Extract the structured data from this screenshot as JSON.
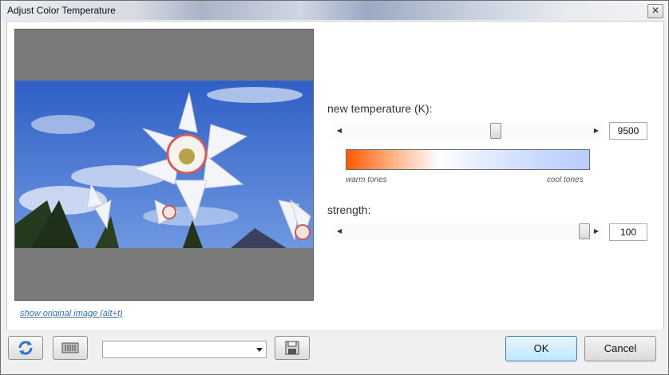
{
  "window": {
    "title": "Adjust Color Temperature",
    "close_icon": "close-icon"
  },
  "preview": {
    "show_original_link": "show original image (alt+t)"
  },
  "temperature": {
    "label": "new temperature (K):",
    "value": "9500",
    "level_fraction": 0.62,
    "warm_label": "warm tones",
    "cool_label": "cool tones",
    "gradient_colors": [
      "#ff5a00",
      "#ffffff",
      "#b8cdff"
    ]
  },
  "strength": {
    "label": "strength:",
    "value": "100",
    "level_fraction": 1.0
  },
  "footer": {
    "reset_icon": "refresh-icon",
    "presets_icon": "presets-icon",
    "preset_value": "",
    "save_icon": "save-icon",
    "ok_label": "OK",
    "cancel_label": "Cancel"
  },
  "colors": {
    "accent": "#3c7fb1",
    "link": "#3a6ea5"
  }
}
